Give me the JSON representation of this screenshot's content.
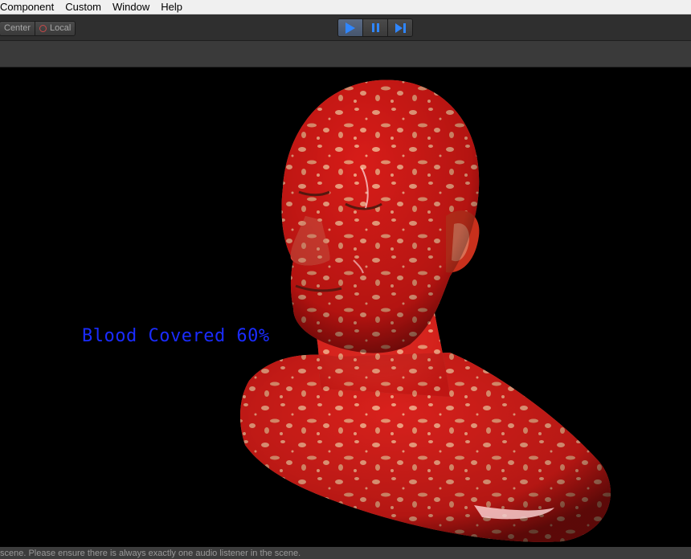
{
  "menu": {
    "items": [
      "Component",
      "Custom",
      "Window",
      "Help"
    ]
  },
  "toolbar": {
    "pivot_label": "Center",
    "space_label": "Local",
    "play_icon": "play-icon",
    "pause_icon": "pause-icon",
    "step_icon": "step-icon",
    "accent_color": "#2f86ff"
  },
  "game_view": {
    "overlay_text": "Blood Covered 60%",
    "overlay_color": "#1a2cff",
    "blood_coverage_percent": 60
  },
  "status": {
    "message": "scene. Please ensure there is always exactly one audio listener in the scene."
  }
}
